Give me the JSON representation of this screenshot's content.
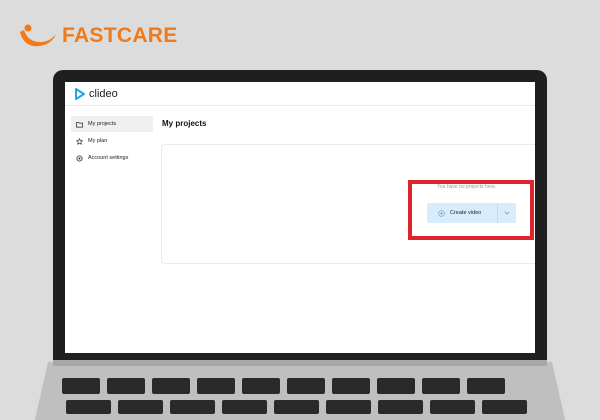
{
  "brand": {
    "name": "FASTCARE",
    "color": "#f07a1a"
  },
  "app": {
    "logo_text": "clideo",
    "logo_color": "#1ea6e8"
  },
  "sidebar": {
    "items": [
      {
        "label": "My projects",
        "icon": "folder-icon",
        "active": true
      },
      {
        "label": "My plan",
        "icon": "star-icon",
        "active": false
      },
      {
        "label": "Account settings",
        "icon": "gear-icon",
        "active": false
      }
    ]
  },
  "main": {
    "title": "My projects",
    "empty_text": "You have no projects here.",
    "create_button": {
      "label": "Create video",
      "icon": "plus-circle-icon",
      "dropdown_icon": "chevron-down-icon"
    }
  },
  "annotation": {
    "highlight_color": "#e0242b"
  }
}
